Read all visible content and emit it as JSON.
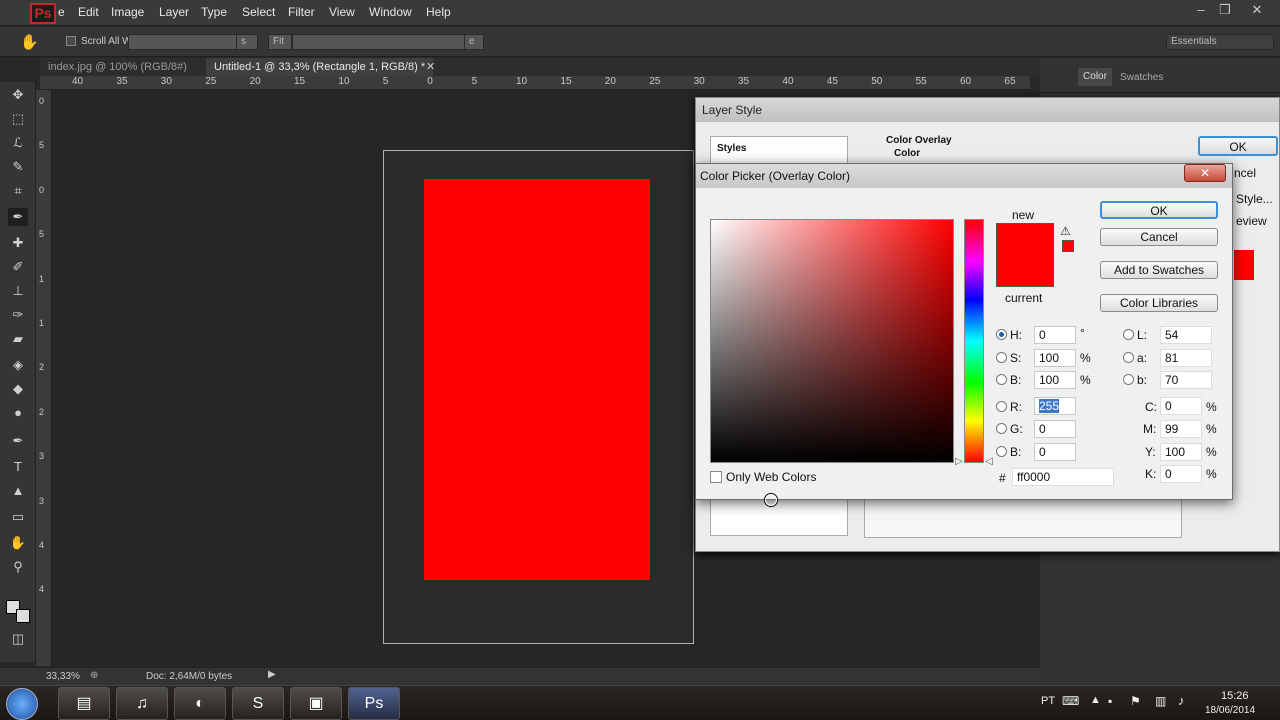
{
  "menubar": {
    "items": [
      "e",
      "Edit",
      "Image",
      "Layer",
      "Type",
      "Select",
      "Filter",
      "View",
      "Window",
      "Help"
    ]
  },
  "options": {
    "scroll_all": "Scroll All W",
    "fit": "Fit",
    "workspace": "Essentials"
  },
  "tabs": [
    {
      "label": "index.jpg @ 100% (RGB/8#)"
    },
    {
      "label": "Untitled-1 @ 33,3% (Rectangle 1, RGB/8) *"
    }
  ],
  "ruler": {
    "h_labels": [
      "40",
      "35",
      "30",
      "25",
      "20",
      "15",
      "10",
      "5",
      "0",
      "5",
      "10",
      "15",
      "20",
      "25",
      "30",
      "35",
      "40",
      "45",
      "50",
      "55",
      "60",
      "65"
    ],
    "v_labels": [
      "0",
      "5",
      "0",
      "5",
      "1",
      "1",
      "2",
      "2",
      "3",
      "3",
      "4",
      "4"
    ]
  },
  "status": {
    "zoom": "33,33%",
    "doc": "Doc: 2,64M/0 bytes"
  },
  "right_panel": {
    "tab_color": "Color",
    "tab_swatches": "Swatches"
  },
  "layer_style": {
    "title": "Layer Style",
    "styles": "Styles",
    "section": "Color Overlay",
    "subsection": "Color",
    "ok": "OK",
    "cancel": "ncel",
    "new_style": "Style...",
    "preview": "eview"
  },
  "picker": {
    "title": "Color Picker (Overlay Color)",
    "close": "✕",
    "new": "new",
    "current": "current",
    "ok": "OK",
    "cancel": "Cancel",
    "add_swatches": "Add to Swatches",
    "libraries": "Color Libraries",
    "only_web": "Only Web Colors",
    "h_label": "H:",
    "h": "0",
    "h_unit": "°",
    "s_label": "S:",
    "s": "100",
    "s_unit": "%",
    "bv_label": "B:",
    "bv": "100",
    "bv_unit": "%",
    "r_label": "R:",
    "r": "255",
    "g_label": "G:",
    "g": "0",
    "b_label": "B:",
    "b": "0",
    "l_label": "L:",
    "l": "54",
    "a_label": "a:",
    "a": "81",
    "lb_label": "b:",
    "lb": "70",
    "c_label": "C:",
    "c": "0",
    "c_unit": "%",
    "m_label": "M:",
    "m": "99",
    "m_unit": "%",
    "y_label": "Y:",
    "y": "100",
    "y_unit": "%",
    "k_label": "K:",
    "k": "0",
    "k_unit": "%",
    "hash": "#",
    "hex": "ff0000",
    "new_color": "#ff0000",
    "current_color": "#ff0000"
  },
  "taskbar": {
    "lang": "PT",
    "time": "15:26",
    "date": "18/06/2014"
  }
}
